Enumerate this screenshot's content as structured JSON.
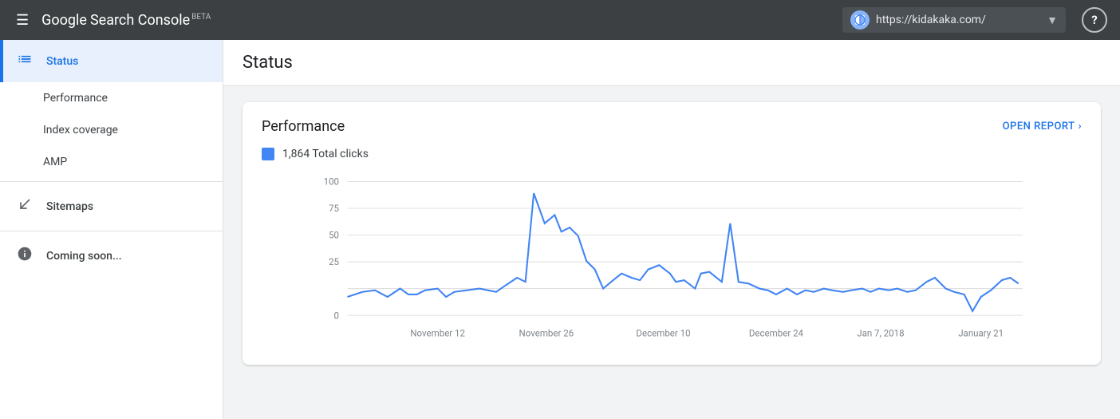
{
  "nav": {
    "hamburger": "☰",
    "brand": {
      "google": "Google",
      "product": "Search Console",
      "beta": "BETA"
    },
    "url": "https://kidakaka.com/",
    "help": "?"
  },
  "sidebar": {
    "items": [
      {
        "id": "status",
        "label": "Status",
        "icon": "📊",
        "active": true
      },
      {
        "id": "sitemaps",
        "label": "Sitemaps",
        "icon": "⬆"
      },
      {
        "id": "coming-soon",
        "label": "Coming soon...",
        "icon": "ℹ"
      }
    ],
    "sub_items": [
      {
        "id": "performance",
        "label": "Performance"
      },
      {
        "id": "index-coverage",
        "label": "Index coverage"
      },
      {
        "id": "amp",
        "label": "AMP"
      }
    ]
  },
  "page": {
    "title": "Status"
  },
  "performance_card": {
    "title": "Performance",
    "open_report_label": "OPEN REPORT",
    "metric": {
      "value": "1,864 Total clicks",
      "color": "#4285f4"
    },
    "chart": {
      "y_labels": [
        "100",
        "75",
        "50",
        "25",
        "0"
      ],
      "x_labels": [
        "November 12",
        "November 26",
        "December 10",
        "December 24",
        "Jan 7, 2018",
        "January 21"
      ]
    }
  }
}
